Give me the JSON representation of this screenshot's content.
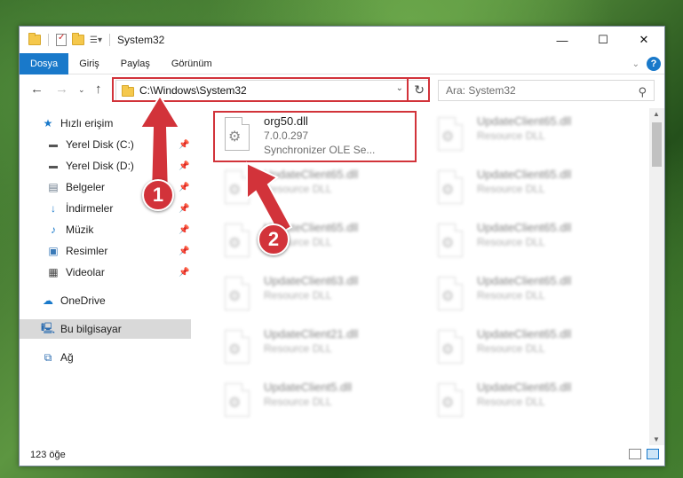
{
  "window": {
    "title": "System32",
    "controls": {
      "minimize": "—",
      "maximize": "☐",
      "close": "✕"
    }
  },
  "ribbon": {
    "tabs": [
      "Dosya",
      "Giriş",
      "Paylaş",
      "Görünüm"
    ],
    "active_tab": "Dosya",
    "help": "?"
  },
  "address": {
    "path": "C:\\Windows\\System32",
    "search_placeholder": "Ara: System32"
  },
  "sidebar": {
    "items": [
      {
        "label": "Hızlı erişim",
        "icon": "star-icon",
        "pinned": false
      },
      {
        "label": "Yerel Disk (C:)",
        "icon": "drive-icon",
        "pinned": true
      },
      {
        "label": "Yerel Disk (D:)",
        "icon": "drive-icon",
        "pinned": true
      },
      {
        "label": "Belgeler",
        "icon": "documents-icon",
        "pinned": true
      },
      {
        "label": "İndirmeler",
        "icon": "download-icon",
        "pinned": true
      },
      {
        "label": "Müzik",
        "icon": "music-icon",
        "pinned": true
      },
      {
        "label": "Resimler",
        "icon": "pictures-icon",
        "pinned": true
      },
      {
        "label": "Videolar",
        "icon": "video-icon",
        "pinned": true
      },
      {
        "label": "OneDrive",
        "icon": "cloud-icon",
        "pinned": false
      },
      {
        "label": "Bu bilgisayar",
        "icon": "computer-icon",
        "pinned": false,
        "selected": true
      },
      {
        "label": "Ağ",
        "icon": "network-icon",
        "pinned": false
      }
    ]
  },
  "files": {
    "highlighted": {
      "name": "org50.dll",
      "version": "7.0.0.297",
      "description": "Synchronizer OLE Se..."
    },
    "left_column": [
      {
        "name": "UpdateClient65.dll",
        "type": "Resource DLL"
      },
      {
        "name": "UpdateClient65.dll",
        "type": "Resource DLL"
      },
      {
        "name": "UpdateClient63.dll",
        "type": "Resource DLL"
      },
      {
        "name": "UpdateClient21.dll",
        "type": "Resource DLL"
      },
      {
        "name": "UpdateClient5.dll",
        "type": "Resource DLL"
      }
    ],
    "right_column": [
      {
        "name": "UpdateClient65.dll",
        "type": "Resource DLL"
      },
      {
        "name": "UpdateClient65.dll",
        "type": "Resource DLL"
      },
      {
        "name": "UpdateClient65.dll",
        "type": "Resource DLL"
      },
      {
        "name": "UpdateClient65.dll",
        "type": "Resource DLL"
      },
      {
        "name": "UpdateClient65.dll",
        "type": "Resource DLL"
      },
      {
        "name": "UpdateClient65.dll",
        "type": "Resource DLL"
      }
    ]
  },
  "status": {
    "item_count": "123 öğe"
  },
  "annotations": {
    "step1": "1",
    "step2": "2",
    "color": "#d2333a"
  }
}
